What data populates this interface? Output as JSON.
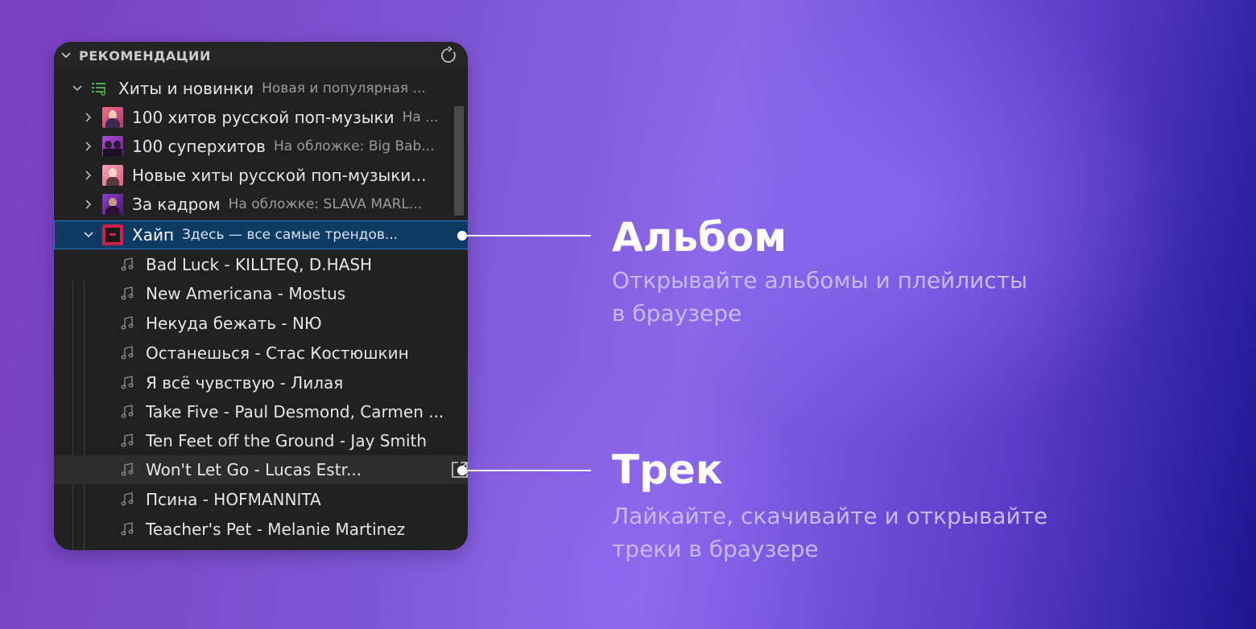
{
  "panel": {
    "header_title": "РЕКОМЕНДАЦИИ",
    "root": {
      "title": "Хиты и новинки",
      "desc": "Новая и популярная ..."
    },
    "playlists": [
      {
        "title": "100 хитов русской поп-музыки",
        "desc": "На ..."
      },
      {
        "title": "100 суперхитов",
        "desc": "На обложке: Big Bab..."
      },
      {
        "title": "Новые хиты русской поп-музыки...",
        "desc": ""
      },
      {
        "title": "За кадром",
        "desc": "На обложке: SLAVA MARL..."
      },
      {
        "title": "Хайп",
        "desc": "Здесь — все самые трендов..."
      }
    ],
    "tracks": [
      {
        "title": "Bad Luck - KILLTEQ, D.HASH"
      },
      {
        "title": "New Americana - Mostus"
      },
      {
        "title": "Некуда бежать - NЮ"
      },
      {
        "title": "Останешься - Стас Костюшкин"
      },
      {
        "title": "Я всё чувствую - Лилая"
      },
      {
        "title": "Take Five - Paul Desmond, Carmen ..."
      },
      {
        "title": "Ten Feet off the Ground - Jay Smith"
      },
      {
        "title": "Won't Let Go - Lucas Estr..."
      },
      {
        "title": "Псина - HOFMANNITA"
      },
      {
        "title": "Teacher's Pet - Melanie Martinez"
      }
    ]
  },
  "callouts": {
    "album": {
      "title": "Альбом",
      "line1": "Открывайте альбомы и плейлисты",
      "line2": "в браузере"
    },
    "track": {
      "title": "Трек",
      "line1": "Лайкайте, скачивайте и открывайте",
      "line2": "треки в браузере"
    }
  },
  "colors": {
    "panel_bg": "#212121",
    "selected_bg": "#0e3a66",
    "selected_border": "#2a73c4",
    "list_icon": "#4caf50"
  }
}
